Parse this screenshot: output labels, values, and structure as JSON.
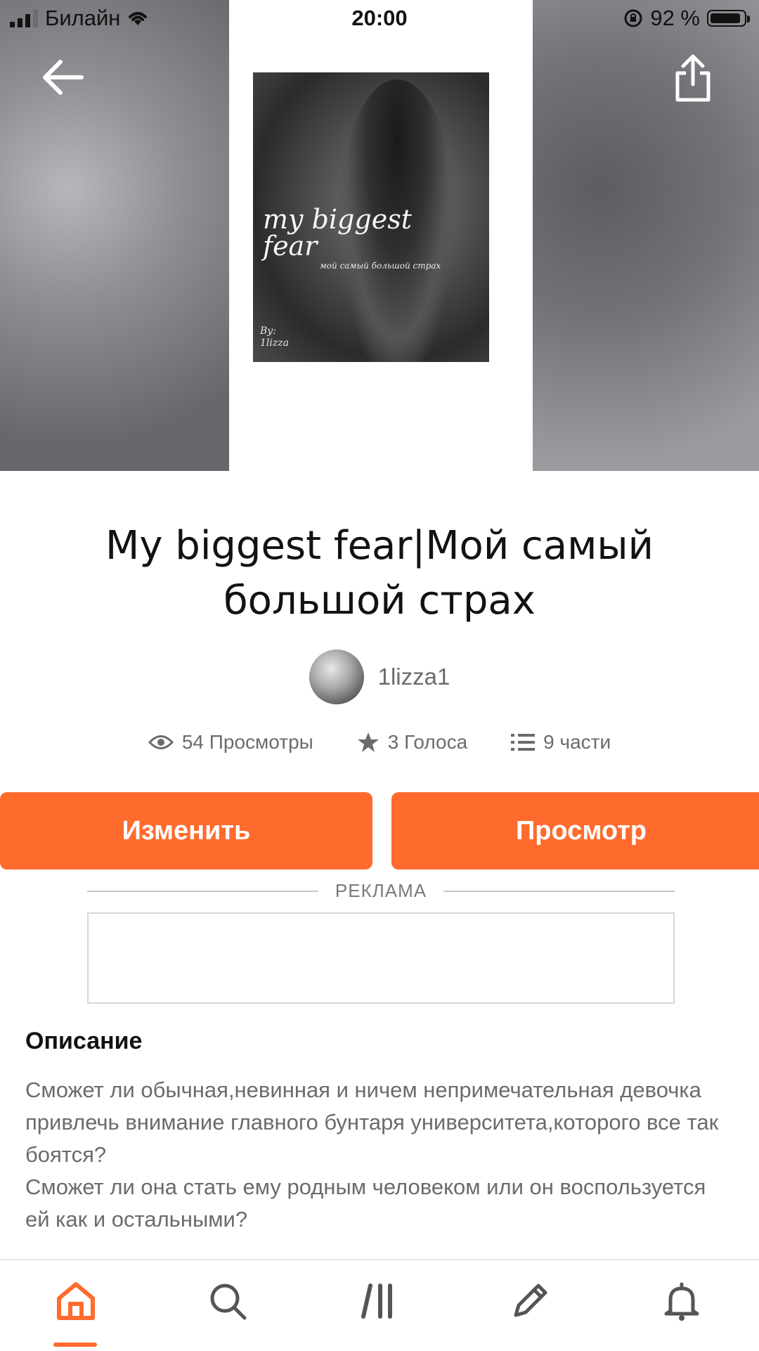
{
  "status": {
    "carrier": "Билайн",
    "time": "20:00",
    "battery": "92 %",
    "battery_level": 0.92
  },
  "header": {
    "back_icon": "arrow-left-icon",
    "share_icon": "share-icon"
  },
  "cover": {
    "title": "my biggest fear",
    "subtitle": "мой самый большой страх",
    "by_line": "By:",
    "by_name": "1lizza"
  },
  "story": {
    "title": "My biggest fear|Мой самый большой страх",
    "author": "1lizza1"
  },
  "stats": {
    "views": "54 Просмотры",
    "votes": "3 Голоса",
    "parts": "9 части"
  },
  "actions": {
    "edit_label": "Изменить",
    "read_label": "Просмотр"
  },
  "ad": {
    "label": "РЕКЛАМА"
  },
  "description": {
    "heading": "Описание",
    "text": "Сможет ли обычная,невинная и ничем непримечательная девочка привлечь внимание главного бунтаря университета,которого все так боятся?\nСможет ли она стать ему родным человеком или он воспользуется ей как и остальными?"
  },
  "bottom_nav": {
    "items": [
      {
        "icon": "home-icon",
        "active": true
      },
      {
        "icon": "search-icon",
        "active": false
      },
      {
        "icon": "library-icon",
        "active": false
      },
      {
        "icon": "pencil-icon",
        "active": false
      },
      {
        "icon": "bell-icon",
        "active": false
      }
    ]
  },
  "colors": {
    "accent": "#ff6b2c",
    "text": "#121212",
    "muted": "#6b6b6b"
  }
}
